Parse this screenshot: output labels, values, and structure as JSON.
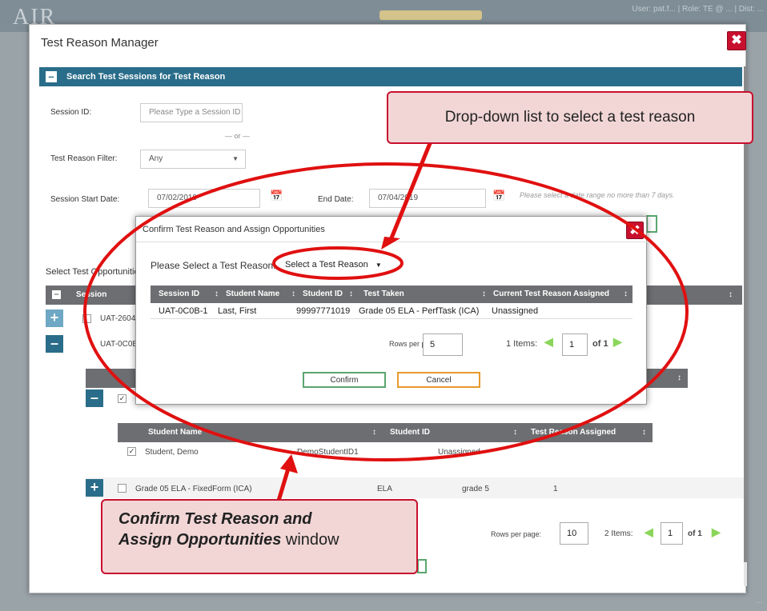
{
  "app": {
    "logo_text": "AIR",
    "user_bar": "User: pat.f... | Role: TE @ ... | Dist: ...",
    "footer_text": "... "
  },
  "dialog": {
    "title": "Test Reason Manager",
    "close_label": "✖"
  },
  "search_panel": {
    "header": "Search Test Sessions for Test Reason",
    "collapse_icon": "–",
    "session_id_label": "Session ID:",
    "session_id_placeholder": "Please Type a Session ID",
    "or_text": "— or —",
    "filter_label": "Test Reason Filter:",
    "filter_value": "Any",
    "start_date_label": "Session Start Date:",
    "start_date_value": "07/02/2019",
    "end_date_label": "End Date:",
    "end_date_value": "07/04/2019",
    "date_note": "Please select a date range no more than 7 days."
  },
  "opportunities": {
    "section_label": "Select Test Opportunities",
    "header_session": "Session",
    "rows": [
      {
        "session": "UAT-2604"
      },
      {
        "session": "UAT-0C0B"
      }
    ],
    "student_table": {
      "headers": [
        "Student Name",
        "Student ID",
        "Test Reason Assigned"
      ],
      "rows": [
        {
          "name": "Student, Demo",
          "id": "DemoStudentID1",
          "reason": "Unassigned"
        }
      ]
    },
    "fixed_form_row": {
      "test": "Grade 05 ELA - FixedForm (ICA)",
      "subject": "ELA",
      "grade": "grade 5",
      "count": "1"
    },
    "pager": {
      "rows_label": "Rows per page:",
      "rows_value": "10",
      "items_text": "2 Items:",
      "page": "1",
      "of_text": "of 1"
    }
  },
  "confirm_window": {
    "title": "Confirm Test Reason and Assign Opportunities",
    "select_label": "Please Select a Test Reason:",
    "select_value": "Select a Test Reason",
    "headers": [
      "Session ID",
      "Student Name",
      "Student ID",
      "Test Taken",
      "Current Test Reason Assigned"
    ],
    "rows": [
      {
        "session_id": "UAT-0C0B-1",
        "student_name": "Last, First",
        "student_id": "99997771019",
        "test_taken": "Grade 05 ELA - PerfTask (ICA)",
        "current_reason": "Unassigned"
      }
    ],
    "pager": {
      "rows_label": "Rows per page:",
      "rows_value": "5",
      "items_text": "1 Items:",
      "page": "1",
      "of_text": "of 1"
    },
    "confirm_label": "Confirm",
    "cancel_label": "Cancel"
  },
  "callouts": {
    "dropdown": "Drop-down list to select a test reason",
    "window_line1": "Confirm Test Reason and",
    "window_line2_italic": "Assign Opportunities",
    "window_line2_rest": " window"
  },
  "colors": {
    "accent": "#2a6d8a",
    "annotation_red": "#e01010",
    "table_header": "#6d6e71"
  }
}
